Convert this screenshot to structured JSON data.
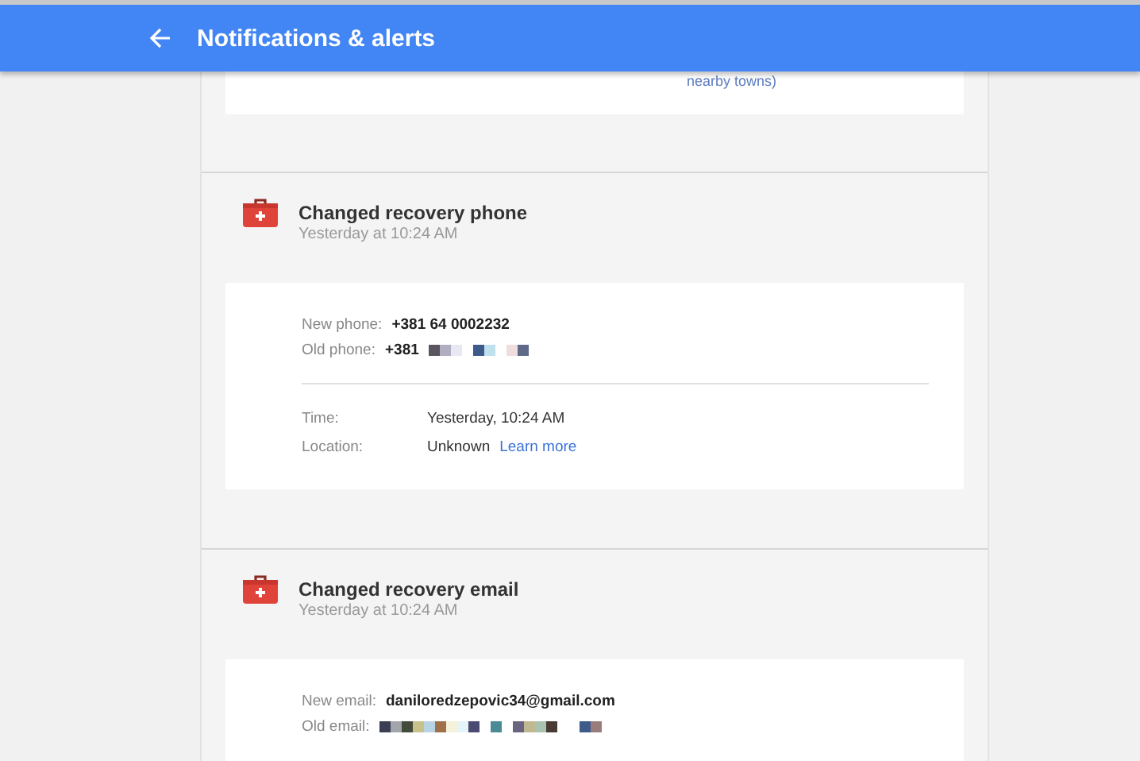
{
  "header": {
    "title": "Notifications & alerts"
  },
  "top_card": {
    "text": "nearby towns)"
  },
  "events": [
    {
      "title": "Changed recovery phone",
      "time": "Yesterday at 10:24 AM",
      "changes": [
        {
          "label": "New phone:",
          "value": "+381 64 0002232",
          "redacted": false
        },
        {
          "label": "Old phone:",
          "value": "+381",
          "redacted": true
        }
      ],
      "meta": [
        {
          "label": "Time:",
          "value": "Yesterday, 10:24 AM"
        },
        {
          "label": "Location:",
          "value": "Unknown",
          "link": "Learn more"
        }
      ]
    },
    {
      "title": "Changed recovery email",
      "time": "Yesterday at 10:24 AM",
      "changes": [
        {
          "label": "New email:",
          "value": "daniloredzepovic34@gmail.com",
          "redacted": false
        },
        {
          "label": "Old email:",
          "redacted": true
        }
      ]
    }
  ]
}
